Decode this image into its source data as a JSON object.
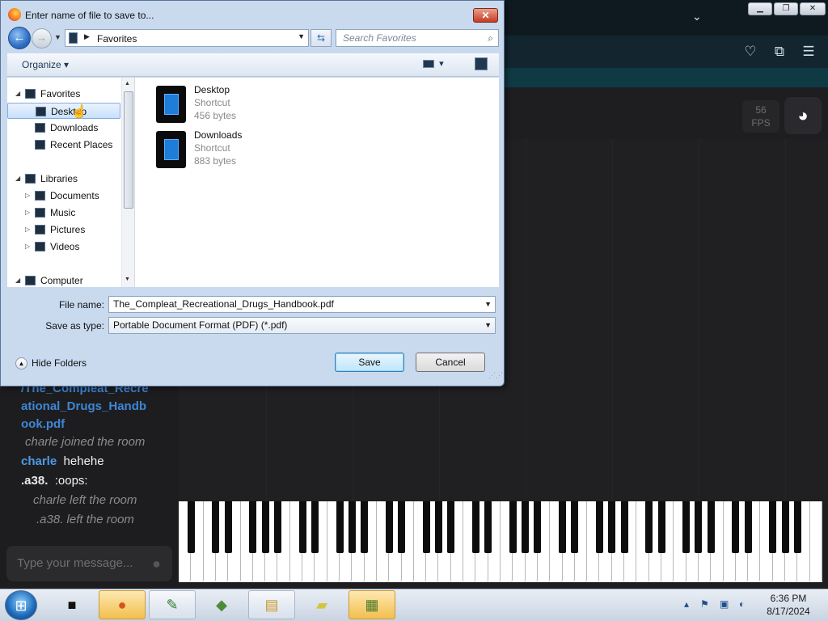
{
  "dialog": {
    "title": "Enter name of file to save to...",
    "close_label": "✕",
    "address": {
      "current": "Favorites"
    },
    "search": {
      "placeholder": "Search Favorites"
    },
    "command_bar": {
      "organize_label": "Organize"
    },
    "nav_tree": [
      {
        "label": "Favorites",
        "level": 0,
        "expanded": true,
        "icon": "favorites-icon"
      },
      {
        "label": "Desktop",
        "level": 1,
        "selected": true,
        "icon": "desktop-icon"
      },
      {
        "label": "Downloads",
        "level": 1,
        "icon": "downloads-icon"
      },
      {
        "label": "Recent Places",
        "level": 1,
        "icon": "recent-places-icon"
      },
      {
        "label": "Libraries",
        "level": 0,
        "expanded": true,
        "icon": "libraries-icon"
      },
      {
        "label": "Documents",
        "level": 1,
        "collapsed": true,
        "icon": "documents-icon"
      },
      {
        "label": "Music",
        "level": 1,
        "collapsed": true,
        "icon": "music-icon"
      },
      {
        "label": "Pictures",
        "level": 1,
        "collapsed": true,
        "icon": "pictures-icon"
      },
      {
        "label": "Videos",
        "level": 1,
        "collapsed": true,
        "icon": "videos-icon"
      },
      {
        "label": "Computer",
        "level": 0,
        "expanded": true,
        "icon": "computer-icon"
      }
    ],
    "files": [
      {
        "name": "Desktop",
        "type": "Shortcut",
        "size": "456 bytes"
      },
      {
        "name": "Downloads",
        "type": "Shortcut",
        "size": "883 bytes"
      }
    ],
    "file_name": {
      "label": "File name:",
      "value": "The_Compleat_Recreational_Drugs_Handbook.pdf"
    },
    "save_as_type": {
      "label": "Save as type:",
      "value": "Portable Document Format (PDF) (*.pdf)"
    },
    "hide_folders_label": "Hide Folders",
    "save_label": "Save",
    "cancel_label": "Cancel"
  },
  "site": {
    "fps_value": "56",
    "fps_label": "FPS",
    "chat": {
      "file_link_partial": [
        "/The_Compleat_Recre",
        "ational_Drugs_Handb",
        "ook.pdf"
      ],
      "messages": [
        {
          "type": "system",
          "text": "charle joined the room"
        },
        {
          "type": "user",
          "user": "charle",
          "text": "hehehe"
        },
        {
          "type": "user",
          "user": ".a38.",
          "text": ":oops:"
        },
        {
          "type": "system",
          "text": "charle left the room"
        },
        {
          "type": "system",
          "text": ".a38. left the room"
        }
      ],
      "input_placeholder": "Type your message..."
    }
  },
  "taskbar": {
    "time": "6:36 PM",
    "date": "8/17/2024"
  },
  "colors": {
    "accent_blue": "#4f9ae6",
    "dialog_frame": "#c9daef",
    "save_button": "#bee6fd"
  }
}
